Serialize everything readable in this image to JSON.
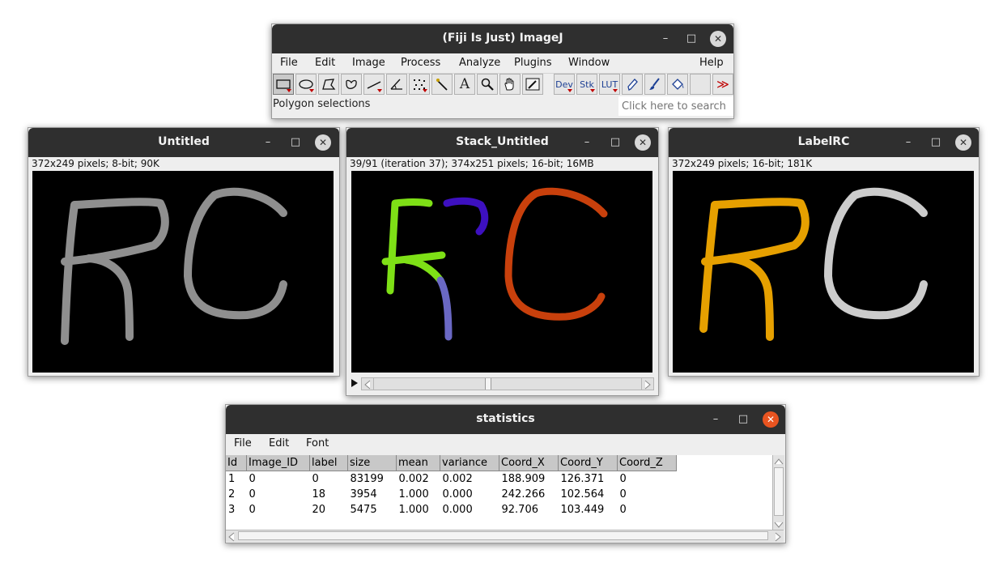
{
  "imagej": {
    "title": "(Fiji Is Just) ImageJ",
    "menu": [
      "File",
      "Edit",
      "Image",
      "Process",
      "Analyze",
      "Plugins",
      "Window",
      "Help"
    ],
    "tools": {
      "dev": "Dev",
      "stk": "Stk",
      "lut": "LUT",
      "text": "A",
      "more": "≫"
    },
    "status": "Polygon selections",
    "search_placeholder": "Click here to search"
  },
  "win_untitled": {
    "title": "Untitled",
    "info": "372x249 pixels; 8-bit; 90K"
  },
  "win_stack": {
    "title": "Stack_Untitled",
    "info": "39/91 (iteration 37); 374x251 pixels; 16-bit; 16MB"
  },
  "win_label": {
    "title": "LabelRC",
    "info": "372x249 pixels; 16-bit; 181K"
  },
  "statistics": {
    "title": "statistics",
    "menu": [
      "File",
      "Edit",
      "Font"
    ],
    "columns": [
      "Id",
      "Image_ID",
      "label",
      "size",
      "mean",
      "variance",
      "Coord_X",
      "Coord_Y",
      "Coord_Z"
    ],
    "rows": [
      [
        "1",
        "0",
        "0",
        "83199",
        "0.002",
        "0.002",
        "188.909",
        "126.371",
        "0"
      ],
      [
        "2",
        "0",
        "18",
        "3954",
        "1.000",
        "0.000",
        "242.266",
        "102.564",
        "0"
      ],
      [
        "3",
        "0",
        "20",
        "5475",
        "1.000",
        "0.000",
        "92.706",
        "103.449",
        "0"
      ]
    ]
  },
  "colors": {
    "gray_stroke": "#8f8f8f",
    "green": "#7ee016",
    "blue": "#3d10c0",
    "lavender": "#6a68c4",
    "rust": "#c8400c",
    "orange": "#e6a000",
    "light_gray": "#cccccc"
  },
  "icons": {
    "minimize": "minimize-icon",
    "maximize": "maximize-icon",
    "close": "close-icon"
  }
}
